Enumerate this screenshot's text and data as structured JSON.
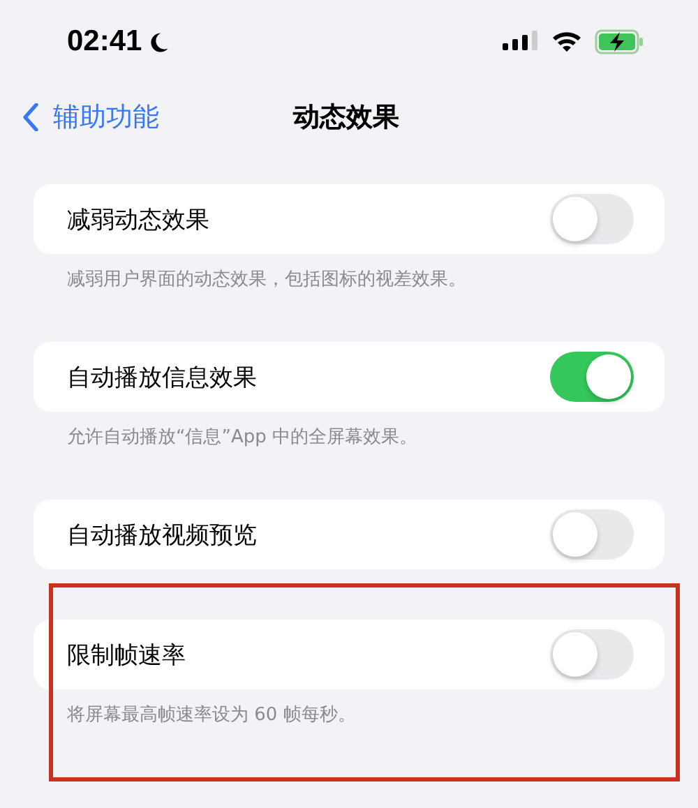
{
  "status_bar": {
    "time": "02:41",
    "focus_mode": true
  },
  "nav": {
    "back_label": "辅助功能",
    "title": "动态效果"
  },
  "settings": [
    {
      "label": "减弱动态效果",
      "on": false,
      "footnote": "减弱用户界面的动态效果，包括图标的视差效果。",
      "highlighted": false
    },
    {
      "label": "自动播放信息效果",
      "on": true,
      "footnote": "允许自动播放“信息”App 中的全屏幕效果。",
      "highlighted": false
    },
    {
      "label": "自动播放视频预览",
      "on": false,
      "highlighted": false
    },
    {
      "label": "限制帧速率",
      "on": false,
      "footnote": "将屏幕最高帧速率设为 60 帧每秒。",
      "highlighted": true
    }
  ]
}
